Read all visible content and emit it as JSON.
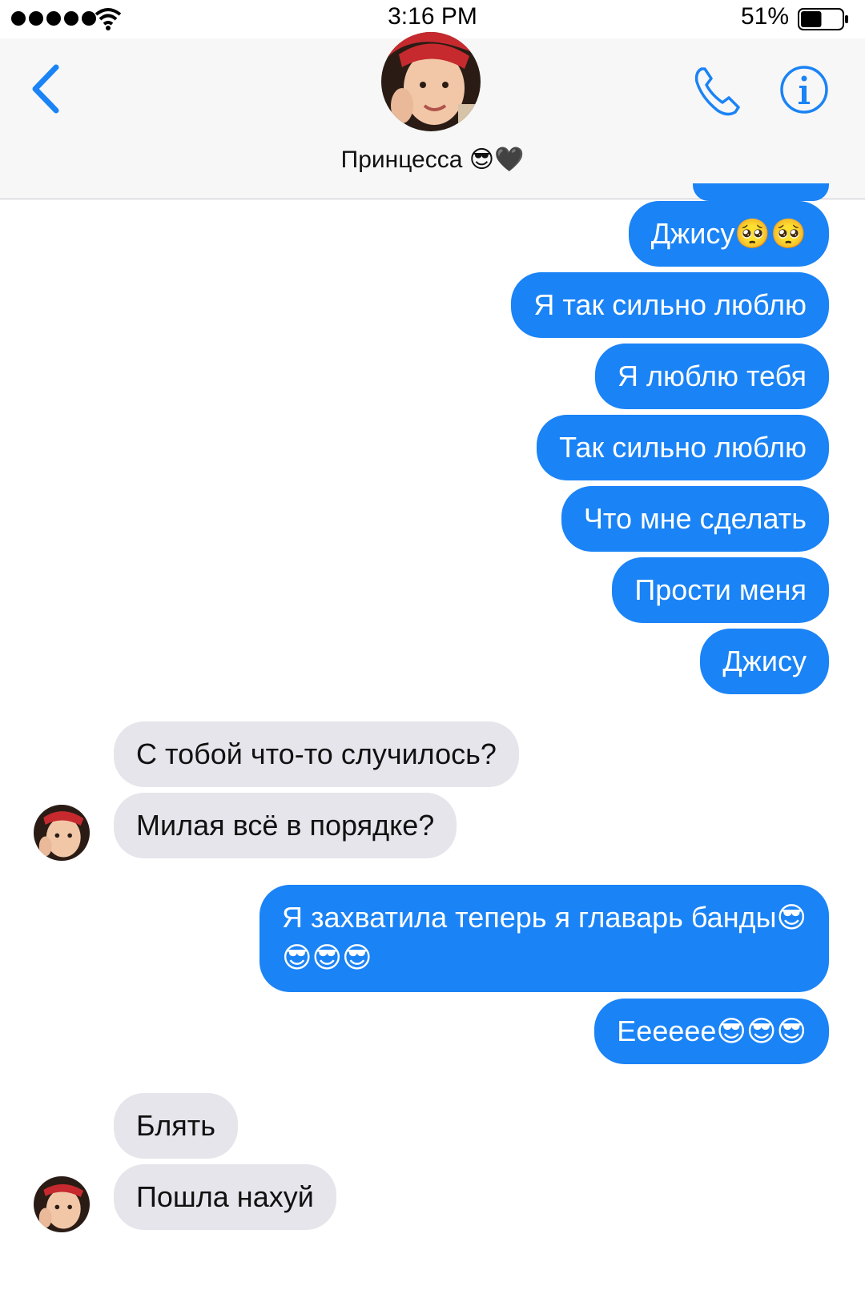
{
  "status_bar": {
    "time": "3:16 PM",
    "battery_percent": "51%",
    "signal_icon": "signal-dots-icon",
    "wifi_icon": "wifi-icon",
    "battery_icon": "battery-icon",
    "battery_level": 0.51
  },
  "header": {
    "contact_name": "Принцесса 😎🖤",
    "back_icon": "chevron-left-icon",
    "call_icon": "phone-icon",
    "info_icon": "info-icon",
    "accent_color": "#1a83f6"
  },
  "messages": [
    {
      "direction": "sent",
      "text": "Джису🥺🥺"
    },
    {
      "direction": "sent",
      "text": "Я так сильно люблю"
    },
    {
      "direction": "sent",
      "text": "Я люблю тебя"
    },
    {
      "direction": "sent",
      "text": "Так сильно люблю"
    },
    {
      "direction": "sent",
      "text": "Что мне сделать"
    },
    {
      "direction": "sent",
      "text": "Прости меня"
    },
    {
      "direction": "sent",
      "text": "Джису"
    },
    {
      "direction": "received",
      "text": "С тобой что-то случилось?"
    },
    {
      "direction": "received",
      "text": "Милая всё в порядке?"
    },
    {
      "direction": "sent",
      "text_line1": "Я захватила теперь я главарь банды😎",
      "text_line2": "😎😎😎"
    },
    {
      "direction": "sent",
      "text": "Ееееее😎😎😎"
    },
    {
      "direction": "received",
      "text": "Блять"
    },
    {
      "direction": "received",
      "text": "Пошла нахуй"
    }
  ],
  "colors": {
    "sent_bubble": "#1a83f6",
    "received_bubble": "#e6e5eb"
  }
}
